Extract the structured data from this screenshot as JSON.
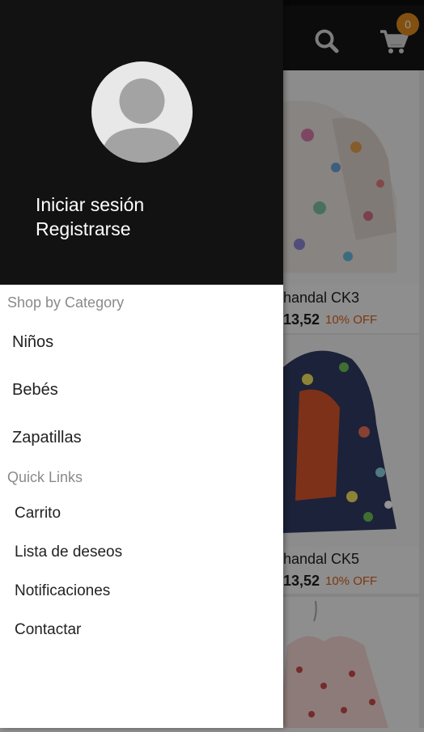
{
  "topbar": {
    "search_icon": "search-icon",
    "cart_icon": "shopping-cart-icon",
    "cart_count": "0"
  },
  "products": [
    {
      "name_partial": "handal CK3",
      "price_partial": "13,52",
      "discount": "10% OFF"
    },
    {
      "name_partial": "handal CK5",
      "price_partial": "13,52",
      "discount": "10% OFF"
    }
  ],
  "drawer": {
    "avatar_icon": "user-avatar-icon",
    "login_label": "Iniciar sesión",
    "register_label": "Registrarse",
    "shop_by_category_title": "Shop by Category",
    "categories": [
      "Niños",
      "Bebés",
      "Zapatillas"
    ],
    "quick_links_title": "Quick Links",
    "quick_links": [
      "Carrito",
      "Lista de deseos",
      "Notificaciones",
      "Contactar"
    ]
  }
}
